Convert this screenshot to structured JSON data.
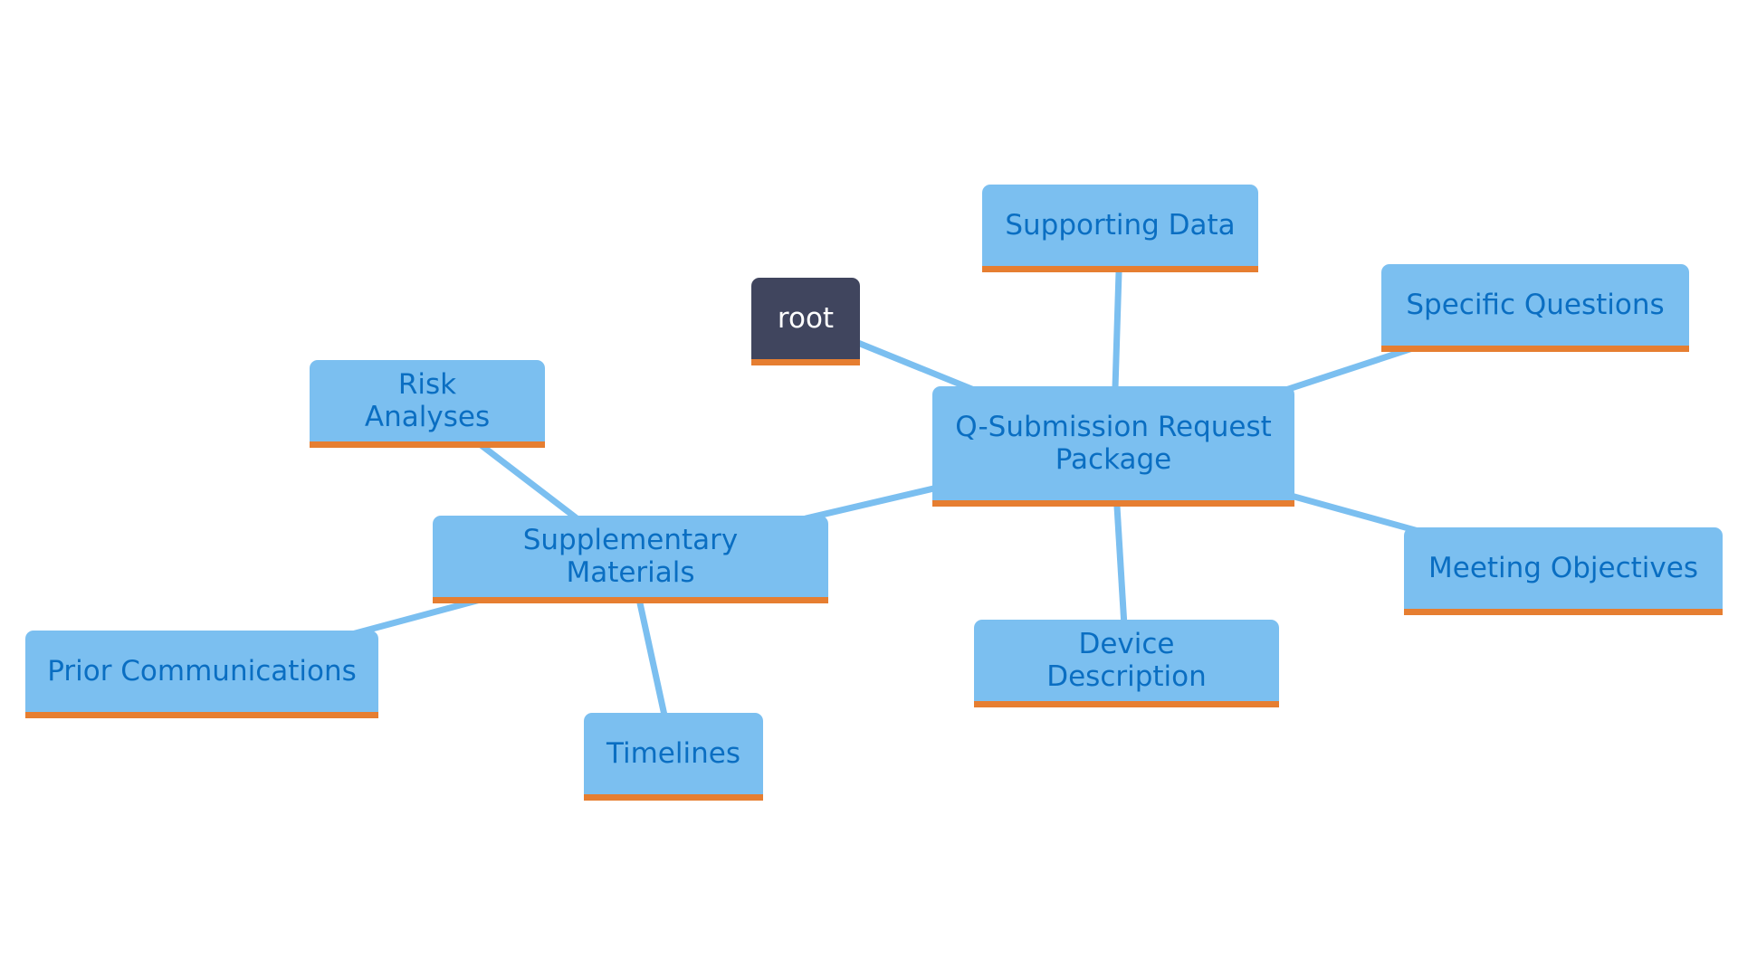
{
  "diagram": {
    "type": "mindmap",
    "colors": {
      "node_fill": "#7bbff0",
      "node_text": "#0a6ec2",
      "node_underline": "#e67e31",
      "root_fill": "#40455e",
      "root_text": "#ffffff",
      "edge": "#7bbff0"
    },
    "nodes": [
      {
        "id": "root",
        "label": "root"
      },
      {
        "id": "qsub",
        "label": "Q-Submission Request\nPackage"
      },
      {
        "id": "supporting",
        "label": "Supporting Data"
      },
      {
        "id": "questions",
        "label": "Specific Questions"
      },
      {
        "id": "objectives",
        "label": "Meeting Objectives"
      },
      {
        "id": "device",
        "label": "Device Description"
      },
      {
        "id": "supplementary",
        "label": "Supplementary Materials"
      },
      {
        "id": "risk",
        "label": "Risk Analyses"
      },
      {
        "id": "prior",
        "label": "Prior Communications"
      },
      {
        "id": "timelines",
        "label": "Timelines"
      }
    ],
    "edges": [
      {
        "from": "root",
        "to": "qsub"
      },
      {
        "from": "qsub",
        "to": "supporting"
      },
      {
        "from": "qsub",
        "to": "questions"
      },
      {
        "from": "qsub",
        "to": "objectives"
      },
      {
        "from": "qsub",
        "to": "device"
      },
      {
        "from": "qsub",
        "to": "supplementary"
      },
      {
        "from": "supplementary",
        "to": "risk"
      },
      {
        "from": "supplementary",
        "to": "prior"
      },
      {
        "from": "supplementary",
        "to": "timelines"
      }
    ]
  }
}
